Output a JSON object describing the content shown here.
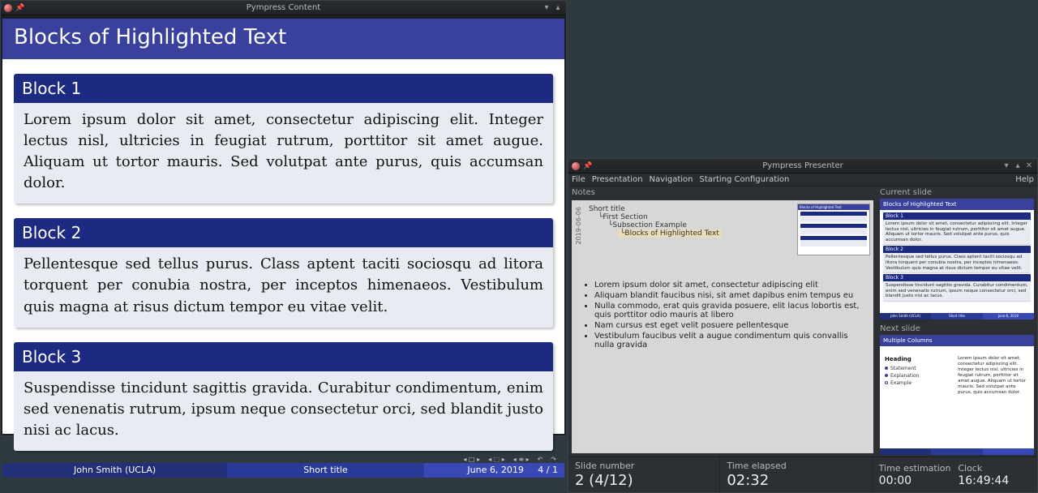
{
  "content_window": {
    "title": "Pympress Content",
    "slide": {
      "title": "Blocks of Highlighted Text",
      "blocks": [
        {
          "title": "Block 1",
          "body": "Lorem ipsum dolor sit amet, consectetur adipiscing elit. Integer lectus nisl, ultricies in feugiat rutrum, porttitor sit amet augue. Aliquam ut tortor mauris. Sed volutpat ante purus, quis accumsan dolor."
        },
        {
          "title": "Block 2",
          "body": "Pellentesque sed tellus purus. Class aptent taciti sociosqu ad litora torquent per conubia nostra, per inceptos himenaeos. Vestibulum quis magna at risus dictum tempor eu vitae velit."
        },
        {
          "title": "Block 3",
          "body": "Suspendisse tincidunt sagittis gravida. Curabitur condimentum, enim sed venenatis rutrum, ipsum neque consectetur orci, sed blandit justo nisi ac lacus."
        }
      ],
      "footer": {
        "author": "John Smith  (UCLA)",
        "title": "Short title",
        "date": "June 6, 2019",
        "page": "4 / 1"
      }
    }
  },
  "presenter_window": {
    "title": "Pympress Presenter",
    "menus": [
      "File",
      "Presentation",
      "Navigation",
      "Starting Configuration"
    ],
    "menu_help": "Help",
    "notes_label": "Notes",
    "outline_date": "2019-06-06",
    "outline": {
      "l1": "Short title",
      "l2": "First Section",
      "l3": "Subsection Example",
      "l4": "Blocks of Highlighted Text"
    },
    "notes_items": [
      "Lorem ipsum dolor sit amet, consectetur adipiscing elit",
      "Aliquam blandit faucibus nisi, sit amet dapibus enim tempus eu",
      "Nulla commodo, erat quis gravida posuere, elit lacus lobortis est, quis porttitor odio mauris at libero",
      "Nam cursus est eget velit posuere pellentesque",
      "Vestibulum faucibus velit a augue condimentum quis convallis nulla gravida"
    ],
    "current_label": "Current slide",
    "next_label": "Next slide",
    "next_slide": {
      "title": "Multiple Columns",
      "heading": "Heading",
      "items": [
        "Statement",
        "Explanation",
        "Example"
      ],
      "body": "Lorem ipsum dolor sit amet, consectetur adipiscing elit. Integer lectus nisl, ultricies in feugiat rutrum, porttitor sit amet augue. Aliquam ut tortor mauris. Sed volutpat ante purus, quis accumsan dolor."
    },
    "status": {
      "slide_number_label": "Slide number",
      "slide_number_value": "2 (4/12)",
      "time_elapsed_label": "Time elapsed",
      "time_elapsed_value": "02:32",
      "time_estimation_label": "Time estimation",
      "time_estimation_value": "00:00",
      "clock_label": "Clock",
      "clock_value": "16:49:44"
    }
  }
}
